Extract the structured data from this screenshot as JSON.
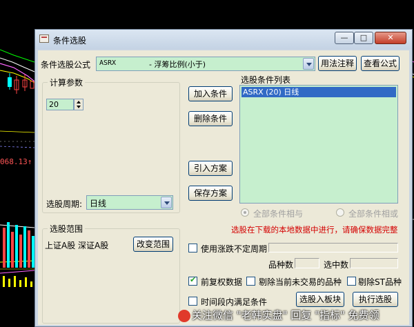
{
  "background": {
    "price_label": "068.13",
    "price_arrow": "↑",
    "price_color": "#ff5555"
  },
  "dialog": {
    "title": "条件选股",
    "title_buttons": {
      "minimize": "—",
      "maximize": "□",
      "close": "✕"
    }
  },
  "formula": {
    "label": "条件选股公式",
    "combo_value_code": "ASRX",
    "combo_value_desc": "-  浮筹比例(小于)",
    "usage_button": "用法注释",
    "view_button": "查看公式"
  },
  "params": {
    "group_title": "计算参数",
    "spin_value": "20",
    "period_label": "选股周期:",
    "period_value": "日线"
  },
  "actions": {
    "add": "加入条件",
    "delete": "删除条件",
    "import": "引入方案",
    "save": "保存方案"
  },
  "conditions": {
    "title": "选股条件列表",
    "items": [
      "ASRX (20) 日线"
    ],
    "radio_and": "全部条件相与",
    "radio_or": "全部条件相或"
  },
  "range": {
    "group_title": "选股范围",
    "value": "上证A股 深证A股",
    "change_button": "改变范围"
  },
  "notice": "选股在下载的本地数据中进行，请确保数据完整",
  "options": {
    "limit_period": "使用涨跌不定周期",
    "count_label": "品种数",
    "selected_label": "选中数",
    "pre_adjust": "前复权数据",
    "exclude_no_trade": "剔除当前未交易的品种",
    "exclude_st": "剔除ST品种",
    "time_range": "时间段内满足条件",
    "to_block": "选股入板块",
    "execute": "执行选股"
  },
  "watermark": {
    "text": "关注微信 \"老韩实盘\" 回复 \"指标\" 免费领"
  },
  "colors": {
    "accent": "#316ac5",
    "field_bg": "#c6efce",
    "notice": "#d40000"
  }
}
